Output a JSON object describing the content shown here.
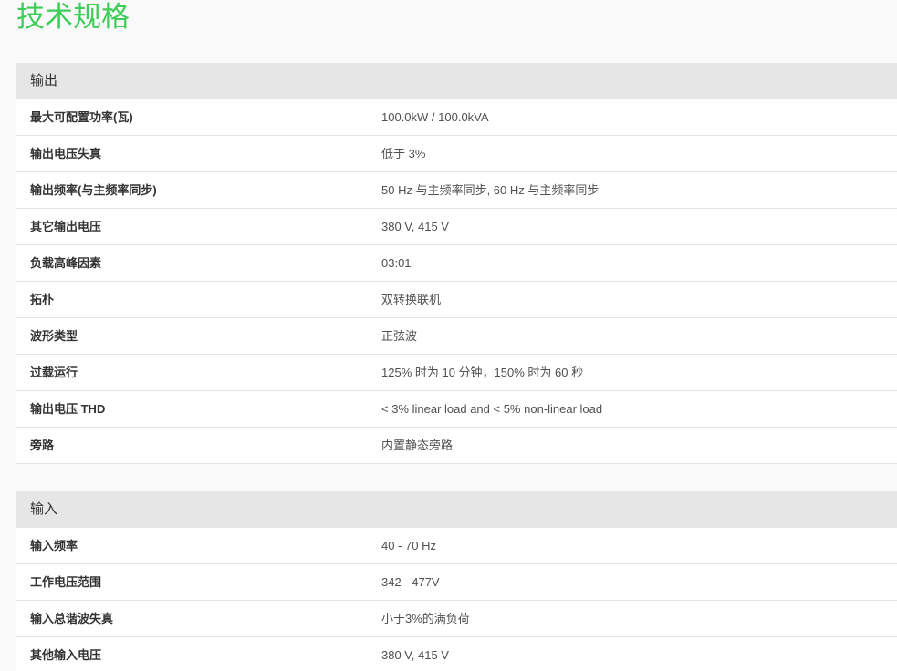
{
  "page_title": "技术规格",
  "sections": [
    {
      "title": "输出",
      "rows": [
        {
          "label": "最大可配置功率(瓦)",
          "value": "100.0kW / 100.0kVA"
        },
        {
          "label": "输出电压失真",
          "value": "低于 3%"
        },
        {
          "label": "输出频率(与主频率同步)",
          "value": "50 Hz 与主频率同步, 60 Hz 与主频率同步"
        },
        {
          "label": "其它输出电压",
          "value": "380 V, 415 V"
        },
        {
          "label": "负载高峰因素",
          "value": "03:01"
        },
        {
          "label": "拓朴",
          "value": "双转换联机"
        },
        {
          "label": "波形类型",
          "value": "正弦波"
        },
        {
          "label": "过载运行",
          "value": "125% 时为 10 分钟，150% 时为 60 秒"
        },
        {
          "label": "输出电压 THD",
          "value": "< 3% linear load and < 5% non-linear load"
        },
        {
          "label": "旁路",
          "value": "内置静态旁路"
        }
      ]
    },
    {
      "title": "输入",
      "rows": [
        {
          "label": "输入频率",
          "value": "40 - 70 Hz"
        },
        {
          "label": "工作电压范围",
          "value": "342 - 477V"
        },
        {
          "label": "输入总谐波失真",
          "value": "小于3%的满负荷"
        },
        {
          "label": "其他输入电压",
          "value": "380 V, 415 V"
        }
      ]
    }
  ]
}
